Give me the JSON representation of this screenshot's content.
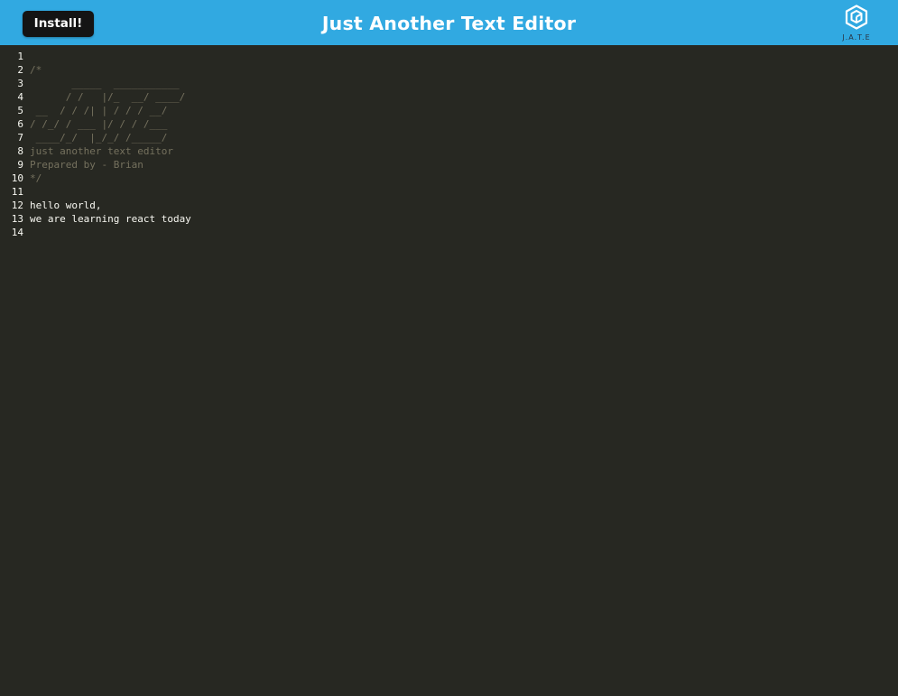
{
  "navbar": {
    "install_label": "Install!",
    "title": "Just Another Text Editor",
    "brand_label": "J.A.T.E",
    "brand_icon": "cube-logo-icon",
    "color": "#31a9e1"
  },
  "editor": {
    "background": "#272822",
    "lines": [
      {
        "number": "1",
        "text": "",
        "kind": "text"
      },
      {
        "number": "2",
        "text": "/*",
        "kind": "comment"
      },
      {
        "number": "3",
        "text": "       _____  ___________",
        "kind": "comment"
      },
      {
        "number": "4",
        "text": "      / /   |/_  __/ ____/",
        "kind": "comment"
      },
      {
        "number": "5",
        "text": " __  / / /| | / / / __/",
        "kind": "comment"
      },
      {
        "number": "6",
        "text": "/ /_/ / ___ |/ / / /___",
        "kind": "comment"
      },
      {
        "number": "7",
        "text": " ____/_/  |_/_/ /_____/",
        "kind": "comment"
      },
      {
        "number": "8",
        "text": "just another text editor",
        "kind": "comment"
      },
      {
        "number": "9",
        "text": "Prepared by - Brian",
        "kind": "comment"
      },
      {
        "number": "10",
        "text": "*/",
        "kind": "comment"
      },
      {
        "number": "11",
        "text": "",
        "kind": "text"
      },
      {
        "number": "12",
        "text": "hello world,",
        "kind": "text"
      },
      {
        "number": "13",
        "text": "we are learning react today",
        "kind": "text"
      },
      {
        "number": "14",
        "text": "",
        "kind": "text"
      }
    ]
  }
}
